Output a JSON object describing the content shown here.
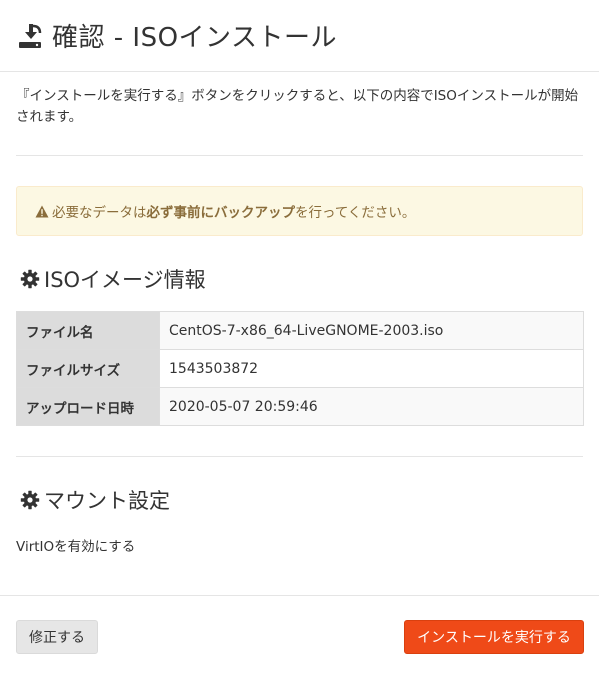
{
  "header": {
    "title": "確認 - ISOインストール",
    "icon": "download-icon"
  },
  "intro": {
    "text": "『インストールを実行する』ボタンをクリックすると、以下の内容でISOインストールが開始されます。"
  },
  "alert": {
    "prefix": "必要なデータは",
    "emphasis": "必ず事前にバックアップ",
    "suffix": "を行ってください。",
    "icon": "warning-icon",
    "color": "#8a6d3b",
    "background": "#fcf8e3"
  },
  "iso_section": {
    "title": "ISOイメージ情報",
    "icon": "gear-icon",
    "rows": [
      {
        "label": "ファイル名",
        "value": "CentOS-7-x86_64-LiveGNOME-2003.iso"
      },
      {
        "label": "ファイルサイズ",
        "value": "1543503872"
      },
      {
        "label": "アップロード日時",
        "value": "2020-05-07 20:59:46"
      }
    ]
  },
  "mount_section": {
    "title": "マウント設定",
    "icon": "gear-icon",
    "virtio_text": "VirtIOを有効にする"
  },
  "footer": {
    "back_label": "修正する",
    "submit_label": "インストールを実行する",
    "submit_color": "#ef4a18"
  }
}
